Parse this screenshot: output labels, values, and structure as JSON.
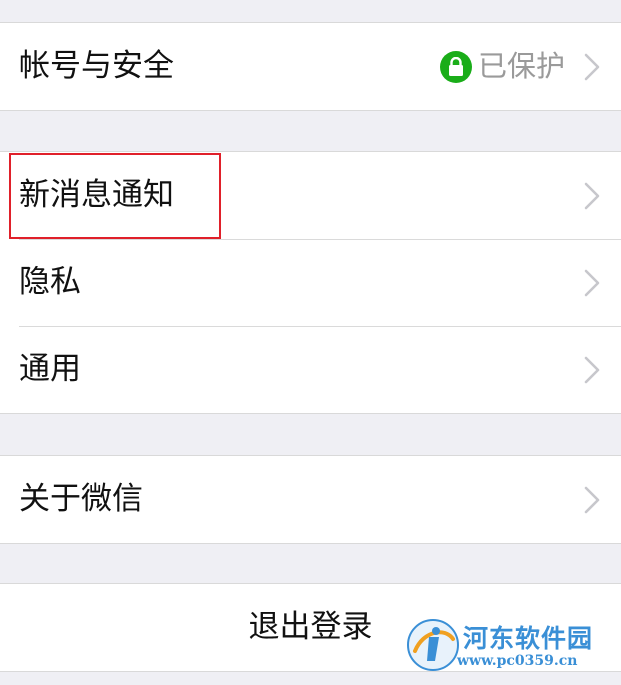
{
  "settings": {
    "groups": [
      {
        "rows": [
          {
            "label": "帐号与安全",
            "status": "已保护"
          }
        ]
      },
      {
        "rows": [
          {
            "label": "新消息通知"
          },
          {
            "label": "隐私"
          },
          {
            "label": "通用"
          }
        ]
      },
      {
        "rows": [
          {
            "label": "关于微信"
          }
        ]
      }
    ],
    "logout_label": "退出登录"
  },
  "colors": {
    "accent_green": "#1aad19",
    "highlight_red": "#e0202a",
    "background": "#efeff4"
  },
  "watermark": {
    "title": "河东软件园",
    "url": "www.pc0359.cn"
  }
}
